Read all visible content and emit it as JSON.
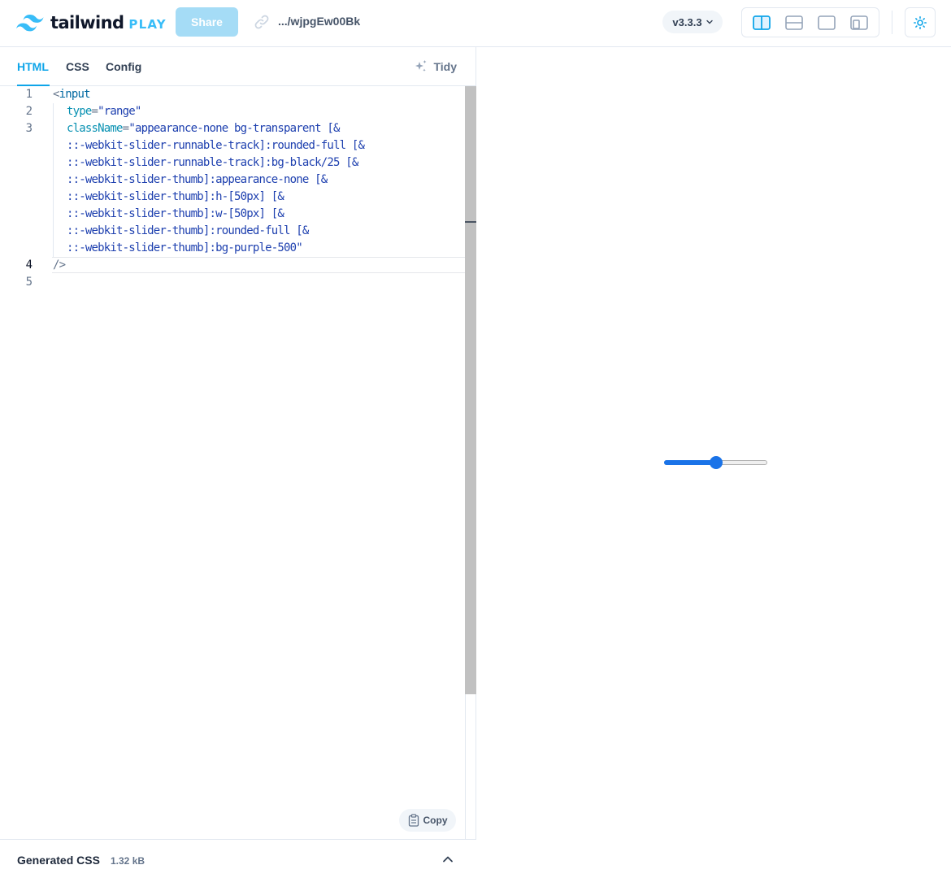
{
  "header": {
    "logo_word": "tailwind",
    "logo_play": "PLAY",
    "share_label": "Share",
    "share_url": ".../wjpgEw00Bk",
    "version": "v3.3.3",
    "layout_buttons": [
      "split-vertical",
      "split-horizontal",
      "preview-only",
      "responsive"
    ],
    "active_layout": "split-vertical"
  },
  "editor": {
    "tabs": [
      {
        "label": "HTML",
        "active": true
      },
      {
        "label": "CSS",
        "active": false
      },
      {
        "label": "Config",
        "active": false
      }
    ],
    "tidy_label": "Tidy",
    "line_numbers": [
      "1",
      "2",
      "3",
      "4",
      "5"
    ],
    "current_line": "4",
    "code": {
      "line1_open": "<",
      "line1_tag": "input",
      "line2_attr": "type",
      "line2_eq": "=",
      "line2_val": "\"range\"",
      "line3_attr": "className",
      "line3_eq": "=",
      "line3_val": "\"appearance-none bg-transparent [&",
      "cont": [
        "::-webkit-slider-runnable-track]:rounded-full [&",
        "::-webkit-slider-runnable-track]:bg-black/25 [&",
        "::-webkit-slider-thumb]:appearance-none [&",
        "::-webkit-slider-thumb]:h-[50px] [&",
        "::-webkit-slider-thumb]:w-[50px] [&",
        "::-webkit-slider-thumb]:rounded-full [&",
        "::-webkit-slider-thumb]:bg-purple-500\""
      ],
      "line4_close": "/>"
    },
    "copy_label": "Copy"
  },
  "generated_css": {
    "title": "Generated CSS",
    "size": "1.32 kB"
  },
  "preview": {
    "slider_value": 0.5
  },
  "colors": {
    "accent": "#0ea5e9",
    "share_bg": "#a5dcf6",
    "slider": "#1a73e8"
  }
}
